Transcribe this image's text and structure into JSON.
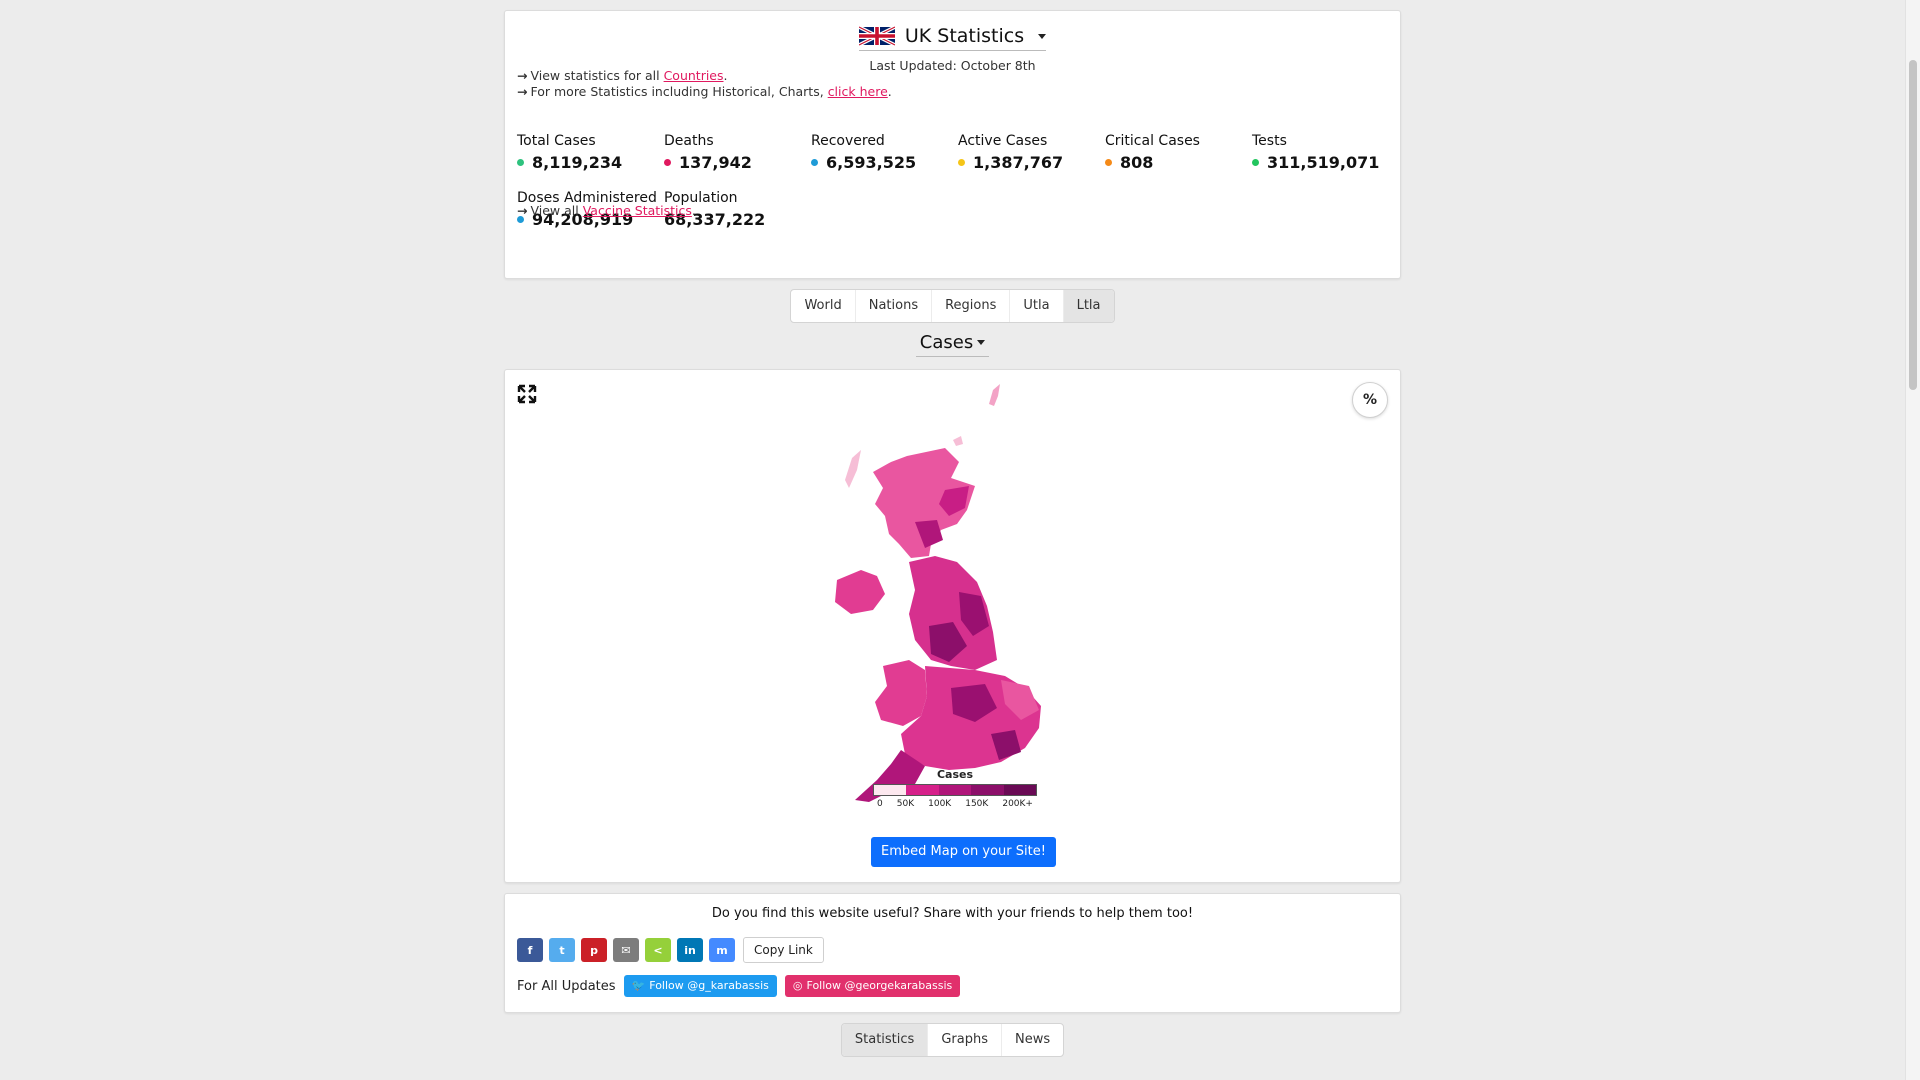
{
  "header": {
    "title": "UK Statistics",
    "last_updated": "Last Updated: October 8th"
  },
  "links": {
    "countries_prefix": "View statistics for all",
    "countries_link": "Countries",
    "more_prefix": "For more Statistics including Historical, Charts,",
    "more_link": "click here",
    "vaccine_prefix": "View all",
    "vaccine_link": "Vaccine Statistics"
  },
  "stats": [
    {
      "label": "Total Cases",
      "value": "8,119,234",
      "color": "#2ec27e"
    },
    {
      "label": "Deaths",
      "value": "137,942",
      "color": "#e0195f"
    },
    {
      "label": "Recovered",
      "value": "6,593,525",
      "color": "#1e9bd7"
    },
    {
      "label": "Active Cases",
      "value": "1,387,767",
      "color": "#f5c518"
    },
    {
      "label": "Critical Cases",
      "value": "808",
      "color": "#f58a18"
    },
    {
      "label": "Tests",
      "value": "311,519,071",
      "color": "#22c55e"
    },
    {
      "label": "Doses Administered",
      "value": "94,208,919",
      "color": "#1e9bd7"
    },
    {
      "label": "Population",
      "value": "68,337,222",
      "color": ""
    }
  ],
  "region_tabs": [
    "World",
    "Nations",
    "Regions",
    "Utla",
    "Ltla"
  ],
  "active_region_tab": "Ltla",
  "metric": "Cases",
  "map": {
    "percent_label": "%",
    "legend_title": "Cases",
    "legend_ticks": [
      "0",
      "50K",
      "100K",
      "150K",
      "200K+"
    ],
    "legend_colors": [
      "#fde8ef",
      "#d6208a",
      "#b0167a",
      "#8c0f6a",
      "#6a0a55"
    ],
    "embed_label": "Embed Map on your Site!"
  },
  "share": {
    "title": "Do you find this website useful? Share with your friends to help them too!",
    "buttons": [
      {
        "icon": "facebook-icon",
        "glyph": "f",
        "color": "#3b5998"
      },
      {
        "icon": "twitter-icon",
        "glyph": "t",
        "color": "#55acee"
      },
      {
        "icon": "pinterest-icon",
        "glyph": "p",
        "color": "#cb2027"
      },
      {
        "icon": "email-icon",
        "glyph": "✉",
        "color": "#7d7d7d"
      },
      {
        "icon": "share-icon",
        "glyph": "<",
        "color": "#95d03a"
      },
      {
        "icon": "linkedin-icon",
        "glyph": "in",
        "color": "#0077b5"
      },
      {
        "icon": "messenger-icon",
        "glyph": "m",
        "color": "#448aff"
      }
    ],
    "copy_label": "Copy Link",
    "updates_label": "For All Updates",
    "twitter_follow": "Follow @g_karabassis",
    "instagram_follow": "Follow @georgekarabassis",
    "twitter_color": "#1d9bf0",
    "instagram_color": "#e1306c"
  },
  "bottom_tabs": [
    "Statistics",
    "Graphs",
    "News"
  ],
  "active_bottom_tab": "Statistics"
}
